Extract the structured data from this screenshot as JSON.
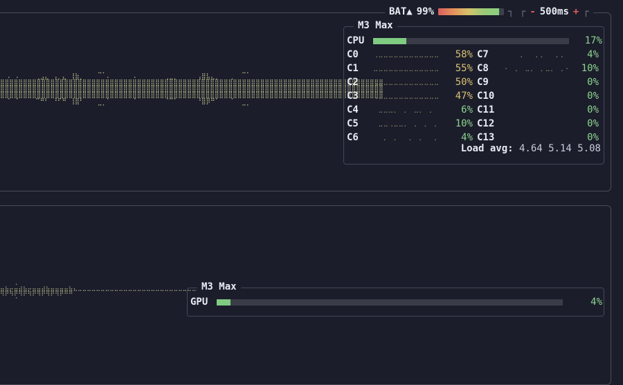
{
  "header": {
    "battery_label": "BAT▲",
    "battery_percent": "99%",
    "battery_level": 0.93,
    "minus": "-",
    "interval": "500ms",
    "plus": "+"
  },
  "cpu": {
    "title": "M3 Max",
    "label": "CPU",
    "percent": "17%",
    "level": 0.17,
    "cores_left": [
      {
        "label": "C0",
        "percent": "58%"
      },
      {
        "label": "C1",
        "percent": "55%"
      },
      {
        "label": "C2",
        "percent": "50%"
      },
      {
        "label": "C3",
        "percent": "47%"
      },
      {
        "label": "C4",
        "percent": "6%"
      },
      {
        "label": "C5",
        "percent": "10%"
      },
      {
        "label": "C6",
        "percent": "4%"
      }
    ],
    "cores_right": [
      {
        "label": "C7",
        "percent": "4%"
      },
      {
        "label": "C8",
        "percent": "10%"
      },
      {
        "label": "C9",
        "percent": "0%"
      },
      {
        "label": "C10",
        "percent": "0%"
      },
      {
        "label": "C11",
        "percent": "0%"
      },
      {
        "label": "C12",
        "percent": "0%"
      },
      {
        "label": "C13",
        "percent": "0%"
      }
    ],
    "load_label": "Load avg:",
    "load_values": "4.64 5.14 5.08"
  },
  "gpu": {
    "title": "M3 Max",
    "label": "GPU",
    "percent": "4%",
    "level": 0.04
  },
  "colors": {
    "background": "#1b1d2b",
    "meter_fill": "#7fcb82",
    "high_pct": "#d9c074",
    "low_pct": "#8ed48f",
    "accent_red": "#e05a5a"
  }
}
